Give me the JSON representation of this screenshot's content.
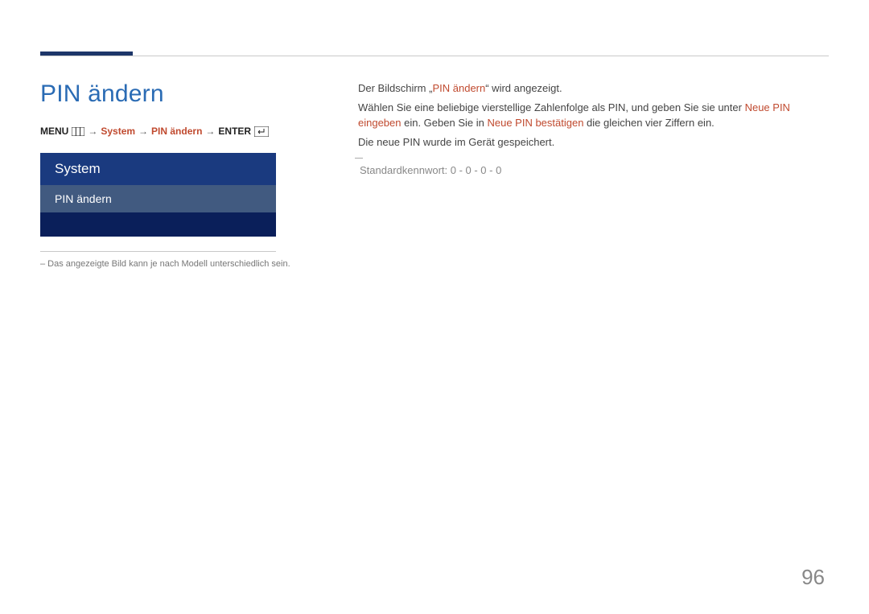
{
  "page_number": "96",
  "heading": "PIN ändern",
  "breadcrumb": {
    "menu": "MENU",
    "system": "System",
    "pin": "PIN ändern",
    "enter": "ENTER"
  },
  "menu": {
    "header": "System",
    "item": "PIN ändern"
  },
  "footnote_left": "–  Das angezeigte Bild kann je nach Modell unterschiedlich sein.",
  "right": {
    "line1_a": "Der Bildschirm „",
    "line1_b": "PIN ändern",
    "line1_c": "“ wird angezeigt.",
    "line2_a": "Wählen Sie eine beliebige vierstellige Zahlenfolge als PIN, und geben Sie sie unter ",
    "line2_b": "Neue PIN eingeben",
    "line2_c": " ein. Geben Sie in ",
    "line2_d": "Neue PIN bestätigen",
    "line2_e": " die gleichen vier Ziffern ein.",
    "line3": "Die neue PIN wurde im Gerät gespeichert.",
    "default_pw": "Standardkennwort: 0 - 0 - 0 - 0"
  }
}
